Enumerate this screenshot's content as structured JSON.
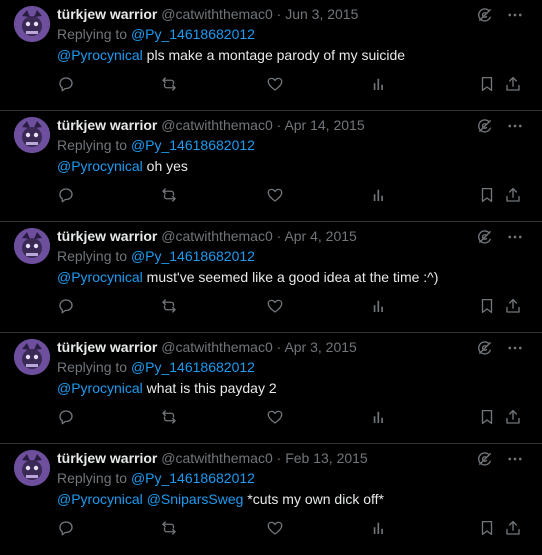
{
  "feed": {
    "tweets": [
      {
        "name": "türkjew warrior",
        "handle": "@catwiththemac0",
        "dot": "·",
        "date": "Jun 3, 2015",
        "replying_prefix": "Replying to ",
        "replying_to": "@Py_14618682012",
        "mentions": [
          "@Pyrocynical"
        ],
        "text": " pls make a montage parody of my suicide"
      },
      {
        "name": "türkjew warrior",
        "handle": "@catwiththemac0",
        "dot": "·",
        "date": "Apr 14, 2015",
        "replying_prefix": "Replying to ",
        "replying_to": "@Py_14618682012",
        "mentions": [
          "@Pyrocynical"
        ],
        "text": " oh yes"
      },
      {
        "name": "türkjew warrior",
        "handle": "@catwiththemac0",
        "dot": "·",
        "date": "Apr 4, 2015",
        "replying_prefix": "Replying to ",
        "replying_to": "@Py_14618682012",
        "mentions": [
          "@Pyrocynical"
        ],
        "text": " must've seemed like a good idea at the time :^)"
      },
      {
        "name": "türkjew warrior",
        "handle": "@catwiththemac0",
        "dot": "·",
        "date": "Apr 3, 2015",
        "replying_prefix": "Replying to ",
        "replying_to": "@Py_14618682012",
        "mentions": [
          "@Pyrocynical"
        ],
        "text": " what is this payday 2"
      },
      {
        "name": "türkjew warrior",
        "handle": "@catwiththemac0",
        "dot": "·",
        "date": "Feb 13, 2015",
        "replying_prefix": "Replying to ",
        "replying_to": "@Py_14618682012",
        "mentions": [
          "@Pyrocynical",
          "@SniparsSweg"
        ],
        "text": " *cuts my own dick off*"
      }
    ]
  },
  "icons": {
    "top": [
      "grok-icon",
      "more-icon"
    ],
    "actions": [
      "reply-icon",
      "retweet-icon",
      "like-icon",
      "views-icon",
      "bookmark-icon",
      "share-icon"
    ]
  },
  "colors": {
    "background": "#000000",
    "text": "#e7e9ea",
    "muted": "#71767b",
    "accent": "#1d9bf0",
    "divider": "#2f3336"
  }
}
